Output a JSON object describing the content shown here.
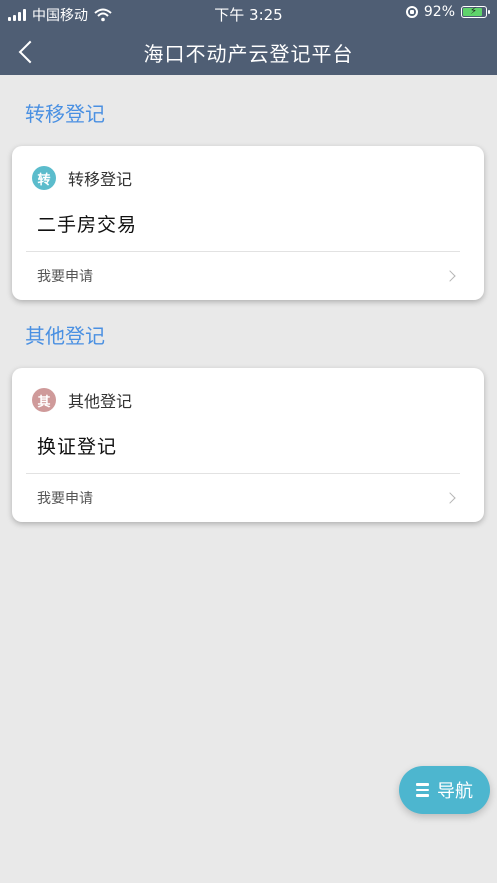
{
  "status_bar": {
    "carrier": "中国移动",
    "time": "下午 3:25",
    "battery_pct": "92%",
    "battery_level": 0.92
  },
  "header": {
    "title": "海口不动产云登记平台"
  },
  "sections": [
    {
      "title": "转移登记",
      "card": {
        "badge": "转",
        "badge_color": "#5bbccc",
        "category": "转移登记",
        "service": "二手房交易",
        "action": "我要申请"
      }
    },
    {
      "title": "其他登记",
      "card": {
        "badge": "其",
        "badge_color": "#cf9a9a",
        "category": "其他登记",
        "service": "换证登记",
        "action": "我要申请"
      }
    }
  ],
  "nav_button": {
    "label": "导航"
  },
  "colors": {
    "header_bg": "#4f5e74",
    "accent": "#4a90e2",
    "nav_bg": "#4db6cf"
  }
}
